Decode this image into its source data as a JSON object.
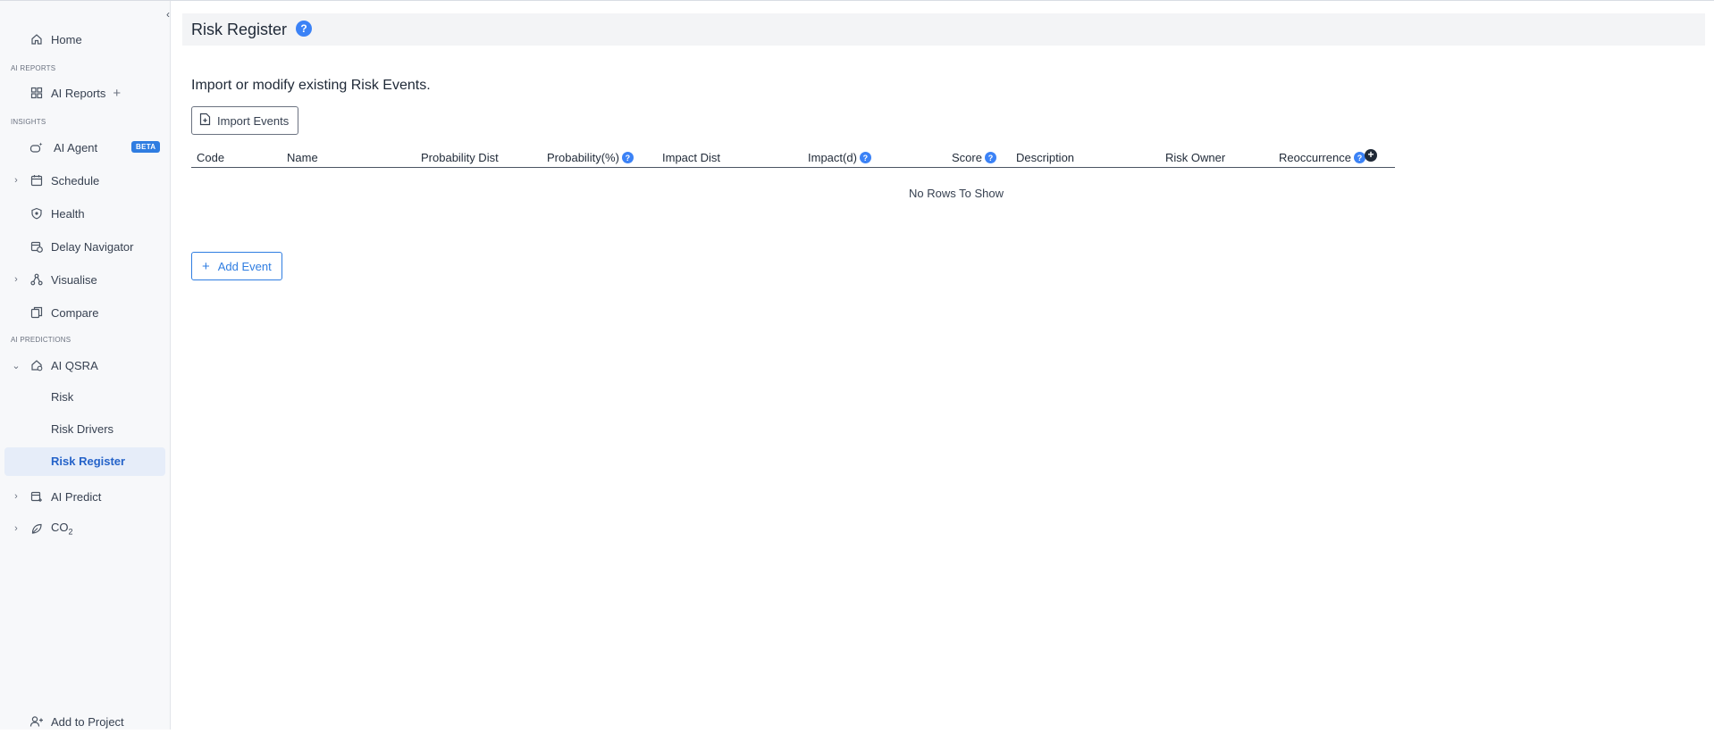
{
  "sidebar": {
    "collapse_glyph": "‹",
    "home": "Home",
    "sections": {
      "ai_reports": "AI REPORTS",
      "insights": "INSIGHTS",
      "ai_predictions": "AI PREDICTIONS"
    },
    "ai_reports": "AI Reports",
    "ai_agent": "AI Agent",
    "beta_badge": "BETA",
    "schedule": "Schedule",
    "health": "Health",
    "delay_navigator": "Delay Navigator",
    "visualise": "Visualise",
    "compare": "Compare",
    "ai_qsra": "AI QSRA",
    "risk": "Risk",
    "risk_drivers": "Risk Drivers",
    "risk_register": "Risk Register",
    "ai_predict": "AI Predict",
    "co2_main": "CO",
    "co2_sub": "2",
    "add_to_project": "Add to Project"
  },
  "header": {
    "title": "Risk Register",
    "help_glyph": "?"
  },
  "main": {
    "intro": "Import or modify existing Risk Events.",
    "import_button": "Import Events",
    "add_button": "Add Event",
    "empty_message": "No Rows To Show"
  },
  "table": {
    "columns": {
      "code": "Code",
      "name": "Name",
      "probability_dist": "Probability Dist",
      "probability": "Probability(%)",
      "impact_dist": "Impact Dist",
      "impact": "Impact(d)",
      "score": "Score",
      "description": "Description",
      "risk_owner": "Risk Owner",
      "reoccurrence": "Reoccurrence"
    }
  },
  "colors": {
    "accent": "#2f7de1",
    "active_bg": "#e6edf9",
    "sidebar_bg": "#f7f8fa"
  }
}
